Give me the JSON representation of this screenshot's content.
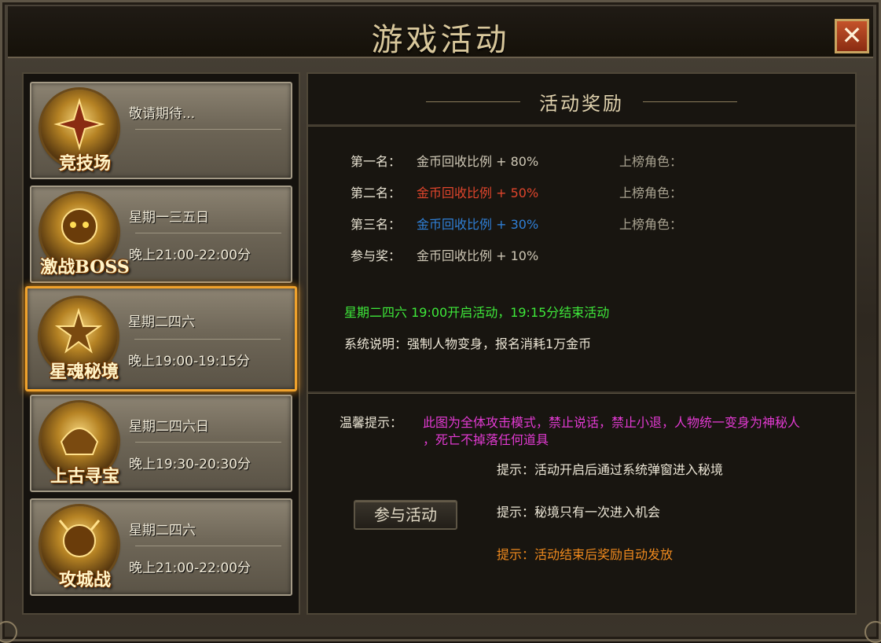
{
  "window": {
    "title": "游戏活动",
    "close_label": "✕"
  },
  "activities": [
    {
      "emblem_name": "竞技场",
      "line1": "敬请期待...",
      "line2": "",
      "selected": false
    },
    {
      "emblem_name": "激战BOSS",
      "line1": "星期一三五日",
      "line2": "晚上21:00-22:00分",
      "selected": false
    },
    {
      "emblem_name": "星魂秘境",
      "line1": "星期二四六",
      "line2": "晚上19:00-19:15分",
      "selected": true
    },
    {
      "emblem_name": "上古寻宝",
      "line1": "星期二四六日",
      "line2": "晚上19:30-20:30分",
      "selected": false
    },
    {
      "emblem_name": "攻城战",
      "line1": "星期二四六",
      "line2": "晚上21:00-22:00分",
      "selected": false
    }
  ],
  "rewards": {
    "heading": "活动奖励",
    "rows": [
      {
        "rank": "第一名：",
        "reward": "金币回收比例 + 80%",
        "role_label": "上榜角色：",
        "color": "#cfc8b6"
      },
      {
        "rank": "第二名：",
        "reward": "金币回收比例 + 50%",
        "role_label": "上榜角色：",
        "color": "#e0452c"
      },
      {
        "rank": "第三名：",
        "reward": "金币回收比例 + 30%",
        "role_label": "上榜角色：",
        "color": "#2f7fd6"
      },
      {
        "rank": "参与奖：",
        "reward": "金币回收比例 + 10%",
        "role_label": "",
        "color": "#cfc8b6"
      }
    ]
  },
  "schedule": "星期二四六 19:00开启活动，19:15分结束活动",
  "system_note": "系统说明：强制人物变身，报名消耗1万金币",
  "warm_tip": {
    "label": "温馨提示：",
    "line1": "此图为全体攻击模式，禁止说话，禁止小退，人物统一变身为神秘人",
    "line2": "，死亡不掉落任何道具"
  },
  "tips": [
    "提示：活动开启后通过系统弹窗进入秘境",
    "提示：秘境只有一次进入机会",
    "提示：活动结束后奖励自动发放"
  ],
  "join_button": "参与活动",
  "colors": {
    "schedule": "#3ee83a",
    "warm_tip": "#e23ad2",
    "tip3": "#f08a1e"
  }
}
